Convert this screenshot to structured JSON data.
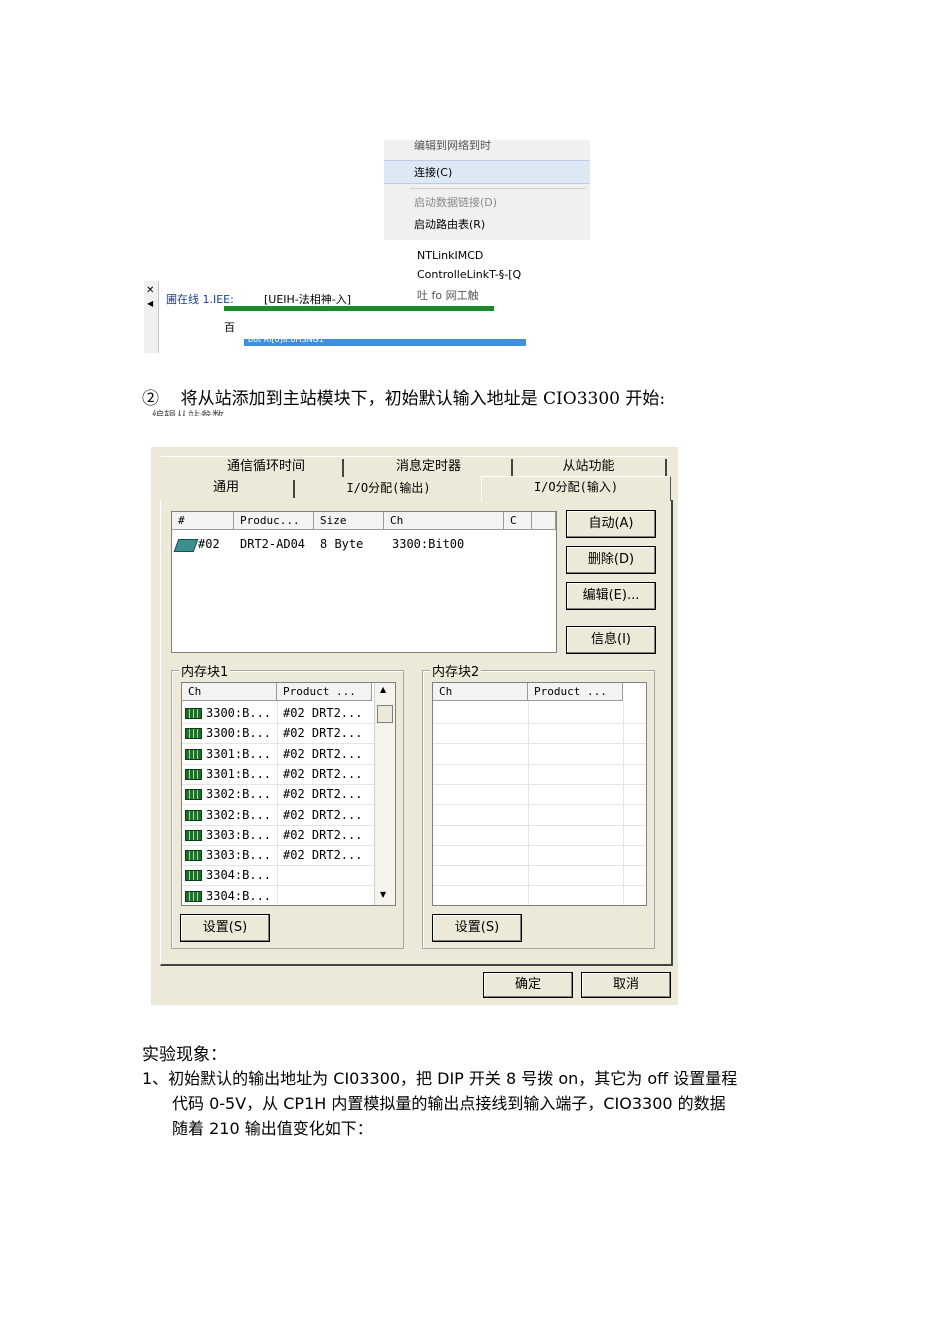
{
  "context_menu": {
    "cut_top": "编辑到网络到时",
    "items": [
      {
        "label": "连接(C)",
        "highlighted": true,
        "disabled": false
      },
      {
        "label": "启动数据链接(D)",
        "highlighted": false,
        "disabled": true
      },
      {
        "label": "启动路由表(R)",
        "highlighted": false,
        "disabled": false
      }
    ]
  },
  "network_list": {
    "lines": [
      "NTLinkIMCD",
      "ControlleLinkT-§-[Q",
      "吐 fo 网工触"
    ],
    "row1_label": "圃在线 1.IEE:",
    "row1_value": "[UEIH-法相神-入]",
    "row2_label": "百",
    "row3_label": "bot Ri[0]8.0HSNG1"
  },
  "step2": {
    "marker": "②",
    "text": "将从站添加到主站模块下，初始默认输入地址是 CIO3300 开始:"
  },
  "caption_cut": "编辑从站参数",
  "dialog": {
    "tabs_back": [
      "通信循环时间",
      "消息定时器",
      "从站功能"
    ],
    "tabs_front": [
      "通用",
      "I/O分配(输出)",
      "I/O分配(输入)"
    ],
    "slave_table": {
      "headers": [
        "#",
        "Produc...",
        "Size",
        "Ch",
        "C"
      ],
      "rows": [
        [
          "#02",
          "DRT2-AD04",
          "8 Byte",
          "3300:Bit00"
        ]
      ]
    },
    "buttons": {
      "auto": "自动(A)",
      "delete": "删除(D)",
      "edit": "编辑(E)...",
      "info": "信息(I)"
    },
    "block1": {
      "title": "内存块1",
      "headers": [
        "Ch",
        "Product ..."
      ],
      "rows": [
        [
          "3300:B...",
          "#02 DRT2..."
        ],
        [
          "3300:B...",
          "#02 DRT2..."
        ],
        [
          "3301:B...",
          "#02 DRT2..."
        ],
        [
          "3301:B...",
          "#02 DRT2..."
        ],
        [
          "3302:B...",
          "#02 DRT2..."
        ],
        [
          "3302:B...",
          "#02 DRT2..."
        ],
        [
          "3303:B...",
          "#02 DRT2..."
        ],
        [
          "3303:B...",
          "#02 DRT2..."
        ],
        [
          "3304:B...",
          ""
        ],
        [
          "3304:B...",
          ""
        ]
      ],
      "set_button": "设置(S)"
    },
    "block2": {
      "title": "内存块2",
      "headers": [
        "Ch",
        "Product ..."
      ],
      "set_button": "设置(S)"
    },
    "ok": "确定",
    "cancel": "取消"
  },
  "results": {
    "heading": "实验现象：",
    "item1_line1": "1、初始默认的输出地址为 CI03300，把 DIP 开关 8 号拨 on，其它为 off 设置量程",
    "item1_line2": "代码 0-5V，从 CP1H 内置模拟量的输出点接线到输入端子，CIO3300 的数据",
    "item1_line3": "随着 210 输出值变化如下："
  }
}
